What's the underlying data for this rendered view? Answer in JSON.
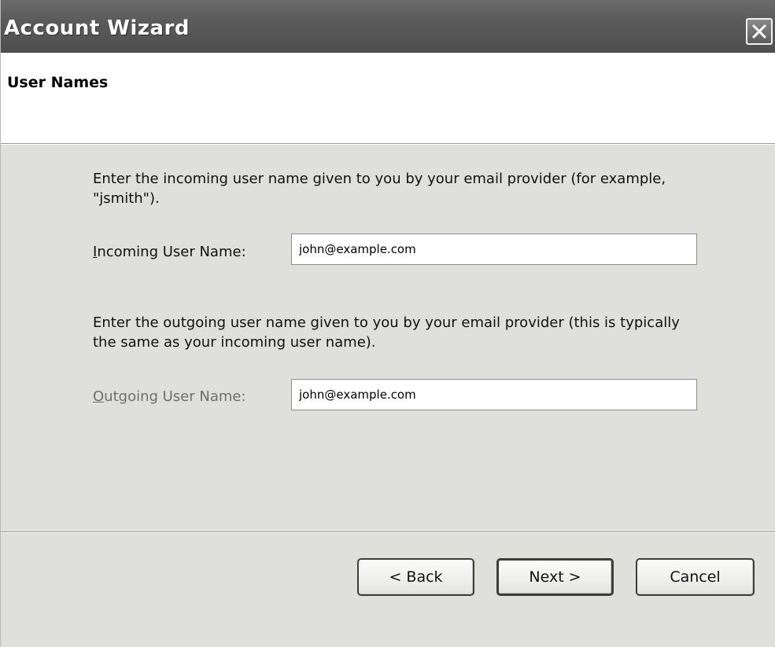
{
  "window": {
    "title": "Account Wizard",
    "close_icon": "close-x-icon"
  },
  "header": {
    "title": "User Names"
  },
  "incoming": {
    "description": "Enter the incoming user name given to you by your email provider (for example, \"jsmith\").",
    "label_accel": "I",
    "label_rest": "ncoming User Name:",
    "value": "john@example.com"
  },
  "outgoing": {
    "description": "Enter the outgoing user name given to you by your email provider (this is typically the same as your incoming user name).",
    "label_accel": "O",
    "label_rest": "utgoing User Name:",
    "value": "john@example.com"
  },
  "buttons": {
    "back": "< Back",
    "next": "Next >",
    "cancel": "Cancel"
  }
}
